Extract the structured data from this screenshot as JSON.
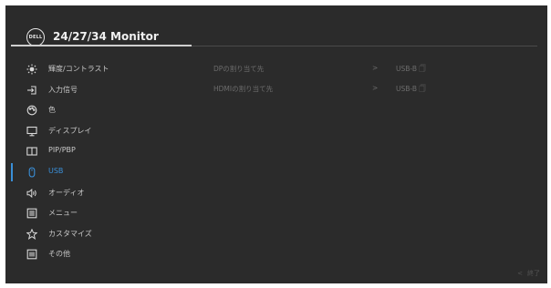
{
  "header": {
    "logo_text": "DELL",
    "title": "24/27/34 Monitor"
  },
  "menu": [
    {
      "label": "輝度/コントラスト",
      "icon": "brightness-icon",
      "active": false
    },
    {
      "label": "入力信号",
      "icon": "input-source-icon",
      "active": false
    },
    {
      "label": "色",
      "icon": "color-palette-icon",
      "active": false
    },
    {
      "label": "ディスプレイ",
      "icon": "display-icon",
      "active": false
    },
    {
      "label": "PIP/PBP",
      "icon": "pip-pbp-icon",
      "active": false
    },
    {
      "label": "USB",
      "icon": "mouse-icon",
      "active": true
    },
    {
      "label": "オーディオ",
      "icon": "speaker-icon",
      "active": false
    },
    {
      "label": "メニュー",
      "icon": "menu-list-icon",
      "active": false
    },
    {
      "label": "カスタマイズ",
      "icon": "star-icon",
      "active": false
    },
    {
      "label": "その他",
      "icon": "others-icon",
      "active": false
    }
  ],
  "submenu": [
    {
      "name": "DPの割り当て先",
      "chevron": ">",
      "value": "USB-B 🗍"
    },
    {
      "name": "HDMIの割り当て先",
      "chevron": ">",
      "value": "USB-B 🗍"
    }
  ],
  "footer": {
    "exit_chevron": "<",
    "exit_label": "終了"
  },
  "colors": {
    "background": "#2b2b2b",
    "accent": "#3a8fd8",
    "text": "#c8c8c8",
    "disabled": "#6c6c6c"
  }
}
